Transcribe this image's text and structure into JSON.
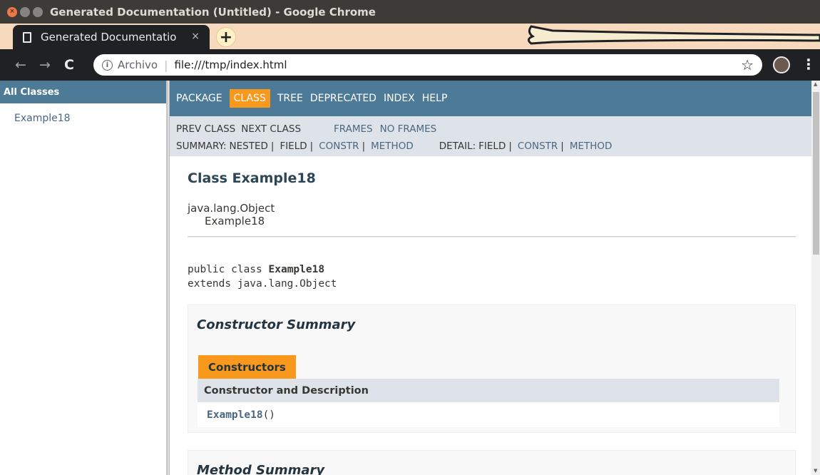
{
  "window": {
    "title": "Generated Documentation (Untitled) - Google Chrome"
  },
  "tab": {
    "title": "Generated Documentatio",
    "close": "×",
    "new_tab": "+"
  },
  "toolbar": {
    "back": "←",
    "forward": "→",
    "reload": "C",
    "scheme_label": "Archivo",
    "separator": "|",
    "url": "file:///tmp/index.html",
    "star": "☆",
    "menu": "⋮",
    "info": "i"
  },
  "left_frame": {
    "header": "All Classes",
    "classes": [
      "Example18"
    ]
  },
  "top_nav": {
    "items": [
      "PACKAGE",
      "CLASS",
      "TREE",
      "DEPRECATED",
      "INDEX",
      "HELP"
    ],
    "active": "CLASS"
  },
  "sub_nav": {
    "prev_class": "PREV CLASS",
    "next_class": "NEXT CLASS",
    "frames": "FRAMES",
    "no_frames": "NO FRAMES",
    "summary_label": "SUMMARY:",
    "summary_nested": "NESTED",
    "summary_field": "FIELD",
    "summary_constr": "CONSTR",
    "summary_method": "METHOD",
    "detail_label": "DETAIL:",
    "detail_field": "FIELD",
    "detail_constr": "CONSTR",
    "detail_method": "METHOD",
    "pipe": "|"
  },
  "content": {
    "class_title": "Class Example18",
    "inheritance": [
      "java.lang.Object",
      "Example18"
    ],
    "declaration_prefix": "public class ",
    "declaration_name": "Example18",
    "declaration_extends": "extends java.lang.Object",
    "constructor_summary": {
      "title": "Constructor Summary",
      "caption": "Constructors",
      "column_header": "Constructor and Description",
      "rows": [
        {
          "name": "Example18",
          "suffix": "()"
        }
      ]
    },
    "method_summary": {
      "title": "Method Summary"
    }
  },
  "colors": {
    "nav_blue": "#4d7a97",
    "accent_orange": "#f8981d",
    "subnav_gray": "#dee3e9",
    "link": "#4a6782",
    "tab_strip": "#f7d9bd"
  }
}
